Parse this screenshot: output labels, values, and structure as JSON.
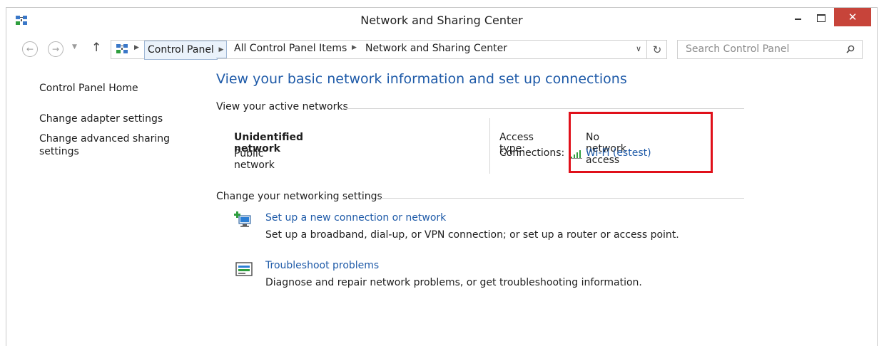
{
  "window": {
    "title": "Network and Sharing Center"
  },
  "address": {
    "crumbs": [
      "Control Panel",
      "All Control Panel Items",
      "Network and Sharing Center"
    ]
  },
  "search": {
    "placeholder": "Search Control Panel"
  },
  "sidebar": {
    "items": [
      {
        "label": "Control Panel Home"
      },
      {
        "label": "Change adapter settings"
      },
      {
        "label": "Change advanced sharing settings"
      }
    ]
  },
  "main": {
    "heading": "View your basic network information and set up connections",
    "active_networks_title": "View your active networks",
    "network": {
      "name": "Unidentified network",
      "category": "Public network",
      "access_type_label": "Access type:",
      "access_type_value": "No network access",
      "connections_label": "Connections:",
      "connection_value": "Wi-Fi (estest)"
    },
    "settings_title": "Change your networking settings",
    "tasks": [
      {
        "link": "Set up a new connection or network",
        "description": "Set up a broadband, dial-up, or VPN connection; or set up a router or access point.",
        "icon": "new-connection-icon"
      },
      {
        "link": "Troubleshoot problems",
        "description": "Diagnose and repair network problems, or get troubleshooting information.",
        "icon": "troubleshoot-icon"
      }
    ]
  },
  "colors": {
    "link": "#1e5aa8",
    "close_button": "#c7443a",
    "highlight": "#e0101a"
  }
}
